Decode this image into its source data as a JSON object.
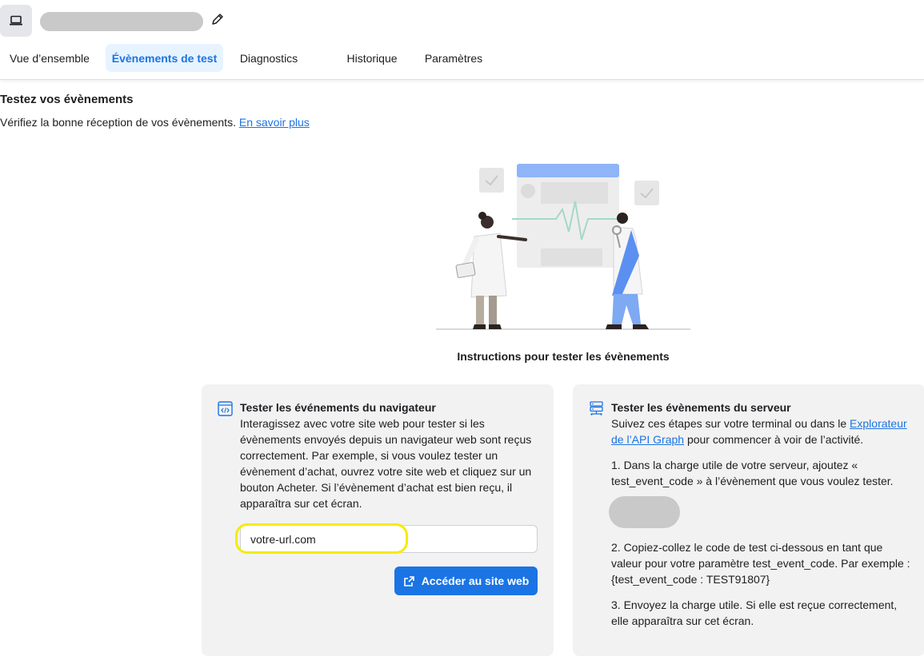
{
  "header": {
    "tabs": [
      {
        "label": "Vue d’ensemble",
        "active": false
      },
      {
        "label": "Évènements de test",
        "active": true
      },
      {
        "label": "Diagnostics",
        "active": false
      },
      {
        "label": "Historique",
        "active": false
      },
      {
        "label": "Paramètres",
        "active": false
      }
    ]
  },
  "intro": {
    "title": "Testez vos évènements",
    "text": "Vérifiez la bonne réception de vos évènements.",
    "link": "En savoir plus"
  },
  "instructions_title": "Instructions pour tester les évènements",
  "browser_card": {
    "title": "Tester les événements du navigateur",
    "text": "Interagissez avec votre site web pour tester si les évènements envoyés depuis un navigateur web sont reçus correctement. Par exemple, si vous voulez tester un évènement d’achat, ouvrez votre site web et cliquez sur un bouton Acheter. Si l’évènement d’achat est bien reçu, il apparaîtra sur cet écran.",
    "url_value": "votre-url.com",
    "button_label": "Accéder au site web"
  },
  "server_card": {
    "title": "Tester les évènements du serveur",
    "intro_before": "Suivez ces étapes sur votre terminal ou dans le ",
    "intro_link": "Explorateur de l’API Graph",
    "intro_after": " pour commencer à voir de l’activité.",
    "step1": "1. Dans la charge utile de votre serveur, ajoutez « test_event_code » à l’évènement que vous voulez tester.",
    "step2": "2. Copiez-collez le code de test ci-dessous en tant que valeur pour votre paramètre test_event_code. Par exemple : {test_event_code : TEST91807}",
    "step3": "3. Envoyez la charge utile. Si elle est reçue correctement, elle apparaîtra sur cet écran."
  },
  "colors": {
    "accent": "#1b74e4",
    "active_tab_bg": "#e7f3ff",
    "card_bg": "#f2f2f2",
    "highlight": "#f5ec00"
  },
  "icons": {
    "app": "laptop-icon",
    "edit": "pencil-icon",
    "browser": "code-window-icon",
    "server": "server-icon",
    "external": "external-link-icon"
  }
}
